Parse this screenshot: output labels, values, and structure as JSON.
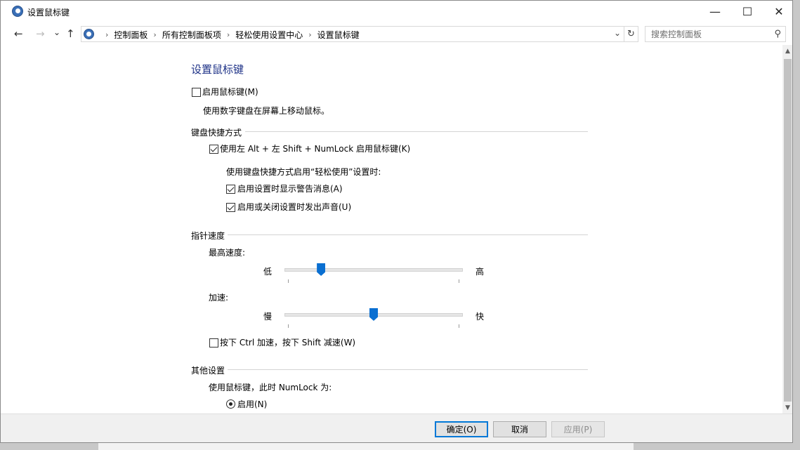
{
  "window": {
    "title": "设置鼠标键",
    "minimize": "—",
    "maximize": "☐",
    "close": "✕"
  },
  "nav": {
    "back": "←",
    "forward": "→",
    "recent": "⌄",
    "up": "↑"
  },
  "address": {
    "crumbs": [
      "控制面板",
      "所有控制面板项",
      "轻松使用设置中心",
      "设置鼠标键"
    ],
    "separator": "›",
    "dropdown": "⌄",
    "refresh": "↻"
  },
  "search": {
    "placeholder": "搜索控制面板",
    "icon": "⚲"
  },
  "page": {
    "title": "设置鼠标键",
    "enable_mouse_keys": {
      "label": "启用鼠标键(M)",
      "checked": false
    },
    "enable_desc": "使用数字键盘在屏幕上移动鼠标。",
    "keyboard_section": {
      "title": "键盘快捷方式",
      "shortcut": {
        "label": "使用左 Alt + 左 Shift + NumLock 启用鼠标键(K)",
        "checked": true
      },
      "sub_title": "使用键盘快捷方式启用“轻松使用”设置时:",
      "warning": {
        "label": "启用设置时显示警告消息(A)",
        "checked": true
      },
      "sound": {
        "label": "启用或关闭设置时发出声音(U)",
        "checked": true
      }
    },
    "pointer_section": {
      "title": "指针速度",
      "top_speed": {
        "label": "最高速度:",
        "low": "低",
        "high": "高",
        "value": 0.18
      },
      "acceleration": {
        "label": "加速:",
        "low": "慢",
        "high": "快",
        "value": 0.5
      },
      "ctrl_shift": {
        "label": "按下 Ctrl 加速，按下 Shift 减速(W)",
        "checked": false
      }
    },
    "other_section": {
      "title": "其他设置",
      "numlock_label": "使用鼠标键，此时 NumLock 为:",
      "on_option": {
        "label": "启用(N)",
        "selected": true
      }
    }
  },
  "footer": {
    "ok": "确定(O)",
    "cancel": "取消",
    "apply": "应用(P)"
  },
  "scrollbar": {
    "up": "▲",
    "down": "▼"
  }
}
